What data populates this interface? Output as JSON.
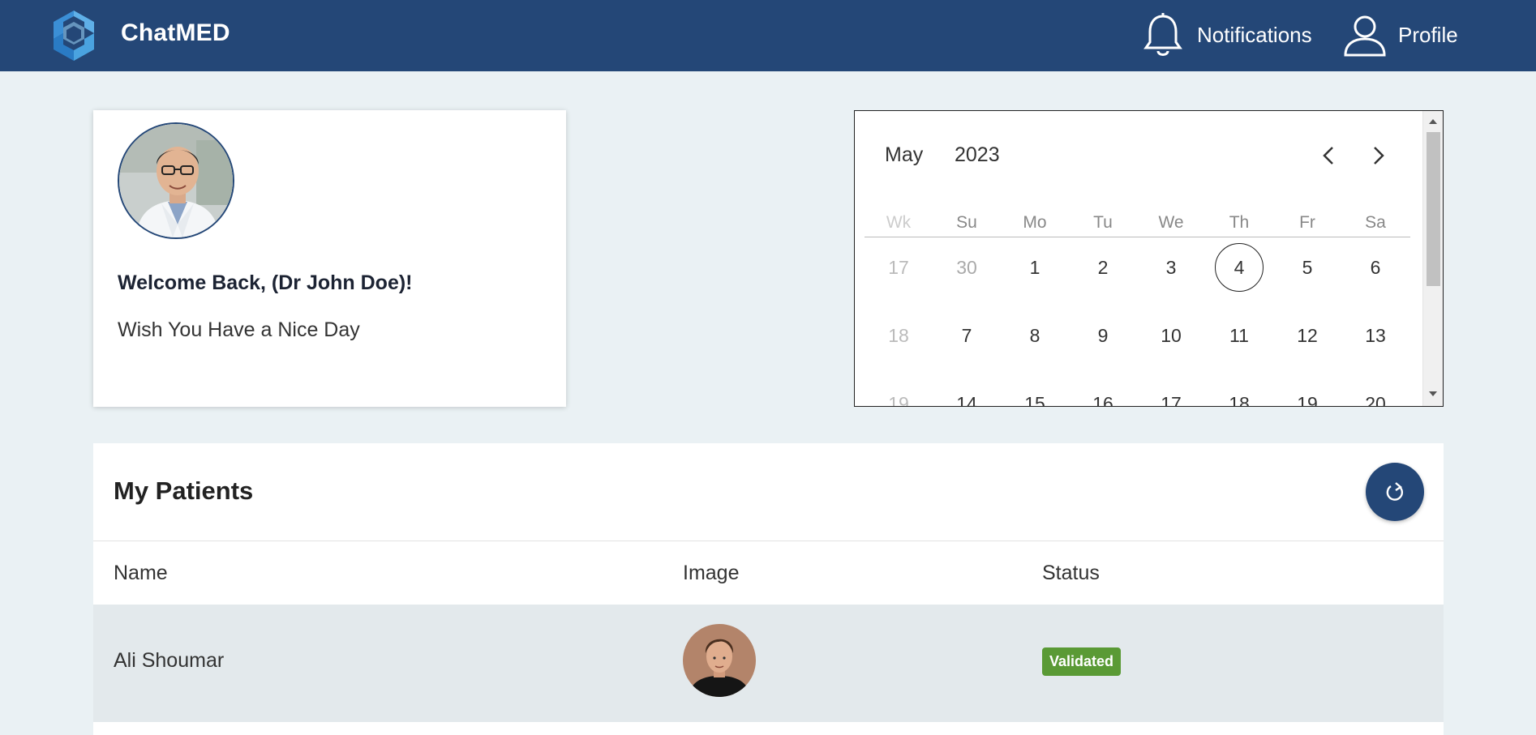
{
  "app": {
    "brand": "ChatMED",
    "logo_icon": "chatmed-logo-icon"
  },
  "nav": {
    "notifications_label": "Notifications",
    "profile_label": "Profile"
  },
  "welcome": {
    "title": "Welcome Back, (Dr John Doe)!",
    "subtitle": "Wish You Have a Nice Day"
  },
  "calendar": {
    "month": "May",
    "year": "2023",
    "headers": [
      "Wk",
      "Su",
      "Mo",
      "Tu",
      "We",
      "Th",
      "Fr",
      "Sa"
    ],
    "today": "4",
    "rows": [
      {
        "week": "17",
        "days": [
          {
            "d": "30",
            "muted": true
          },
          {
            "d": "1"
          },
          {
            "d": "2"
          },
          {
            "d": "3"
          },
          {
            "d": "4",
            "today": true
          },
          {
            "d": "5"
          },
          {
            "d": "6"
          }
        ]
      },
      {
        "week": "18",
        "days": [
          {
            "d": "7"
          },
          {
            "d": "8"
          },
          {
            "d": "9"
          },
          {
            "d": "10"
          },
          {
            "d": "11"
          },
          {
            "d": "12"
          },
          {
            "d": "13"
          }
        ]
      },
      {
        "week": "19",
        "days": [
          {
            "d": "14"
          },
          {
            "d": "15"
          },
          {
            "d": "16"
          },
          {
            "d": "17"
          },
          {
            "d": "18"
          },
          {
            "d": "19"
          },
          {
            "d": "20"
          }
        ]
      }
    ]
  },
  "patients": {
    "title": "My Patients",
    "columns": {
      "name": "Name",
      "image": "Image",
      "status": "Status"
    },
    "rows": [
      {
        "name": "Ali Shoumar",
        "status": "Validated"
      }
    ]
  },
  "colors": {
    "header_bg": "#244777",
    "page_bg": "#eaf1f4",
    "status_validated": "#5a9a35"
  }
}
